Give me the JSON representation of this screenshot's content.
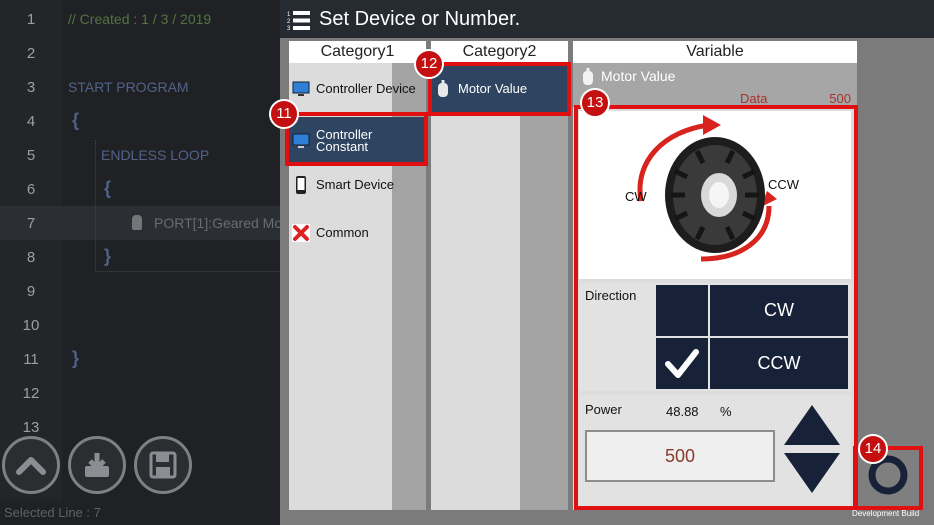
{
  "editor": {
    "lines": [
      {
        "num": "1",
        "text": "//    Created : 1 / 3 / 2019"
      },
      {
        "num": "2",
        "text": ""
      },
      {
        "num": "3",
        "text": "START PROGRAM"
      },
      {
        "num": "4",
        "text": "{"
      },
      {
        "num": "5",
        "text": "ENDLESS LOOP"
      },
      {
        "num": "6",
        "text": "{"
      },
      {
        "num": "7",
        "text": "PORT[1]:Geared Mo"
      },
      {
        "num": "8",
        "text": "}"
      },
      {
        "num": "9",
        "text": ""
      },
      {
        "num": "10",
        "text": ""
      },
      {
        "num": "11",
        "text": "}"
      },
      {
        "num": "12",
        "text": ""
      },
      {
        "num": "13",
        "text": ""
      }
    ],
    "status": "Selected Line : 7",
    "tool_icons": [
      "chevron-up-icon",
      "download-icon",
      "save-icon"
    ]
  },
  "dialog": {
    "title": "Set Device or Number.",
    "category1": {
      "header": "Category1",
      "items": [
        {
          "label": "Controller Device",
          "icon": "monitor-icon"
        },
        {
          "label": "Controller\nConstant",
          "icon": "monitor-icon",
          "selected": true
        },
        {
          "label": "Smart Device",
          "icon": "smartphone-icon"
        },
        {
          "label": "Common",
          "icon": "x-icon"
        }
      ]
    },
    "category2": {
      "header": "Category2",
      "items": [
        {
          "label": "Motor Value",
          "icon": "motor-icon",
          "selected": true
        }
      ]
    },
    "variable": {
      "header": "Variable",
      "name": "Motor Value",
      "data_label": "Data",
      "data_value": "500",
      "cw_label": "CW",
      "ccw_label": "CCW",
      "direction_label": "Direction",
      "direction_options": [
        "CW",
        "CCW"
      ],
      "direction_selected": "CCW",
      "power_label": "Power",
      "power_percent": "48.88",
      "power_unit": "%",
      "power_value": "500"
    },
    "dev_build": "Development Build"
  },
  "annotations": [
    "11",
    "12",
    "13",
    "14"
  ],
  "colors": {
    "highlight": "#e01010",
    "selected_bg": "#2e4460",
    "dark_button": "#172238",
    "data_text": "#a8332d"
  }
}
